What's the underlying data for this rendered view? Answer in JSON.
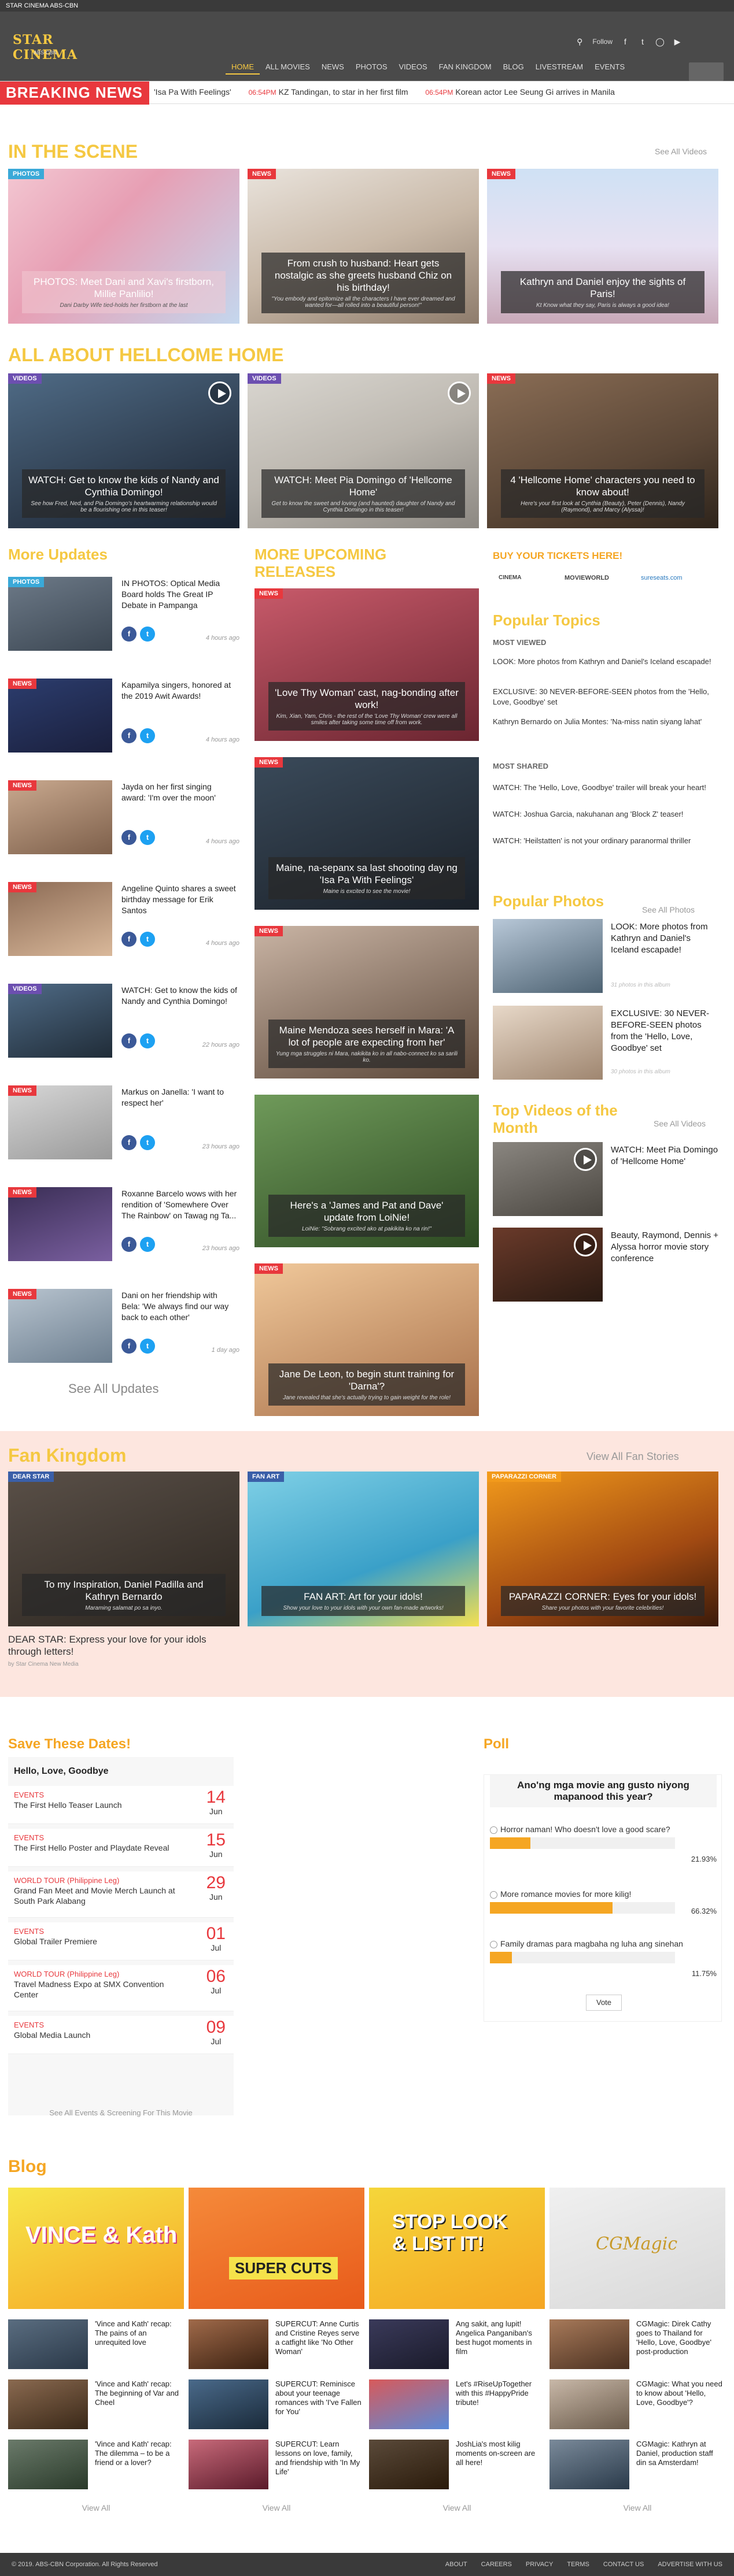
{
  "topbar": {
    "label": "STAR CINEMA ABS-CBN"
  },
  "header": {
    "logo_text": "STAR CINEMA",
    "logo_sub": "ABS-CBN",
    "follow_label": "Follow",
    "nav": [
      "HOME",
      "ALL MOVIES",
      "NEWS",
      "PHOTOS",
      "VIDEOS",
      "FAN KINGDOM",
      "BLOG",
      "LIVESTREAM",
      "EVENTS"
    ]
  },
  "breaking": {
    "label": "BREAKING NEWS",
    "items": [
      {
        "time": "",
        "text": "'Isa Pa With Feelings'"
      },
      {
        "time": "06:54PM",
        "text": "KZ Tandingan, to star in her first film"
      },
      {
        "time": "06:54PM",
        "text": "Korean actor Lee Seung Gi arrives in Manila"
      }
    ]
  },
  "scene": {
    "title": "IN THE SCENE",
    "see_all": "See All Videos",
    "cards": [
      {
        "tag": "PHOTOS",
        "headline": "PHOTOS: Meet Dani and Xavi's firstborn, Millie Panlilio!",
        "sub": "Dani Darby Wife tied-holds her firstborn at the last"
      },
      {
        "tag": "NEWS",
        "headline": "From crush to husband: Heart gets nostalgic as she greets husband Chiz on his birthday!",
        "sub": "\"You embody and epitomize all the characters I have ever dreamed and wanted for—all rolled into a beautiful person!\""
      },
      {
        "tag": "NEWS",
        "headline": "Kathryn and Daniel enjoy the sights of Paris!",
        "sub": "Kt Know what they say, Paris is always a good idea!"
      }
    ]
  },
  "hellcome": {
    "title": "ALL ABOUT HELLCOME HOME",
    "cards": [
      {
        "tag": "VIDEOS",
        "headline": "WATCH: Get to know the kids of Nandy and Cynthia Domingo!",
        "sub": "See how Fred, Ned, and Pia Domingo's heartwarming relationship would be a flourishing one in this teaser!"
      },
      {
        "tag": "VIDEOS",
        "headline": "WATCH: Meet Pia Domingo of 'Hellcome Home'",
        "sub": "Get to know the sweet and loving (and haunted) daughter of Nandy and Cynthia Domingo in this teaser!"
      },
      {
        "tag": "NEWS",
        "headline": "4 'Hellcome Home' characters you need to know about!",
        "sub": "Here's your first look at Cynthia (Beauty), Peter (Dennis), Nandy (Raymond), and Marcy (Alyssa)!"
      }
    ]
  },
  "more_updates": {
    "title": "More Updates",
    "see_all": "See All Updates",
    "items": [
      {
        "tag": "PHOTOS",
        "title": "IN PHOTOS: Optical Media Board holds The Great IP Debate in Pampanga",
        "time": "4 hours ago"
      },
      {
        "tag": "NEWS",
        "title": "Kapamilya singers, honored at the 2019 Awit Awards!",
        "time": "4 hours ago"
      },
      {
        "tag": "NEWS",
        "title": "Jayda on her first singing award: 'I'm over the moon'",
        "time": "4 hours ago"
      },
      {
        "tag": "NEWS",
        "title": "Angeline Quinto shares a sweet birthday message for Erik Santos",
        "time": "4 hours ago"
      },
      {
        "tag": "VIDEOS",
        "title": "WATCH: Get to know the kids of Nandy and Cynthia Domingo!",
        "time": "22 hours ago"
      },
      {
        "tag": "NEWS",
        "title": "Markus on Janella: 'I want to respect her'",
        "time": "23 hours ago"
      },
      {
        "tag": "NEWS",
        "title": "Roxanne Barcelo wows with her rendition of 'Somewhere Over The Rainbow' on Tawag ng Ta...",
        "time": "23 hours ago"
      },
      {
        "tag": "NEWS",
        "title": "Dani on her friendship with Bela: 'We always find our way back to each other'",
        "time": "1 day ago"
      }
    ]
  },
  "upcoming": {
    "title": "MORE UPCOMING RELEASES",
    "cards": [
      {
        "tag": "NEWS",
        "headline": "'Love Thy Woman' cast, nag-bonding after work!",
        "sub": "Kim, Xian, Yam, Chris - the rest of the 'Love Thy Woman' crew were all smiles after taking some time off from work."
      },
      {
        "tag": "NEWS",
        "headline": "Maine, na-sepanx sa last shooting day ng 'Isa Pa With Feelings'",
        "sub": "Maine is excited to see the movie!"
      },
      {
        "tag": "NEWS",
        "headline": "Maine Mendoza sees herself in Mara: 'A lot of people are expecting from her'",
        "sub": "Yung mga struggles ni Mara, nakikita ko in all nabo-connect ko sa sarili ko."
      },
      {
        "tag": "",
        "headline": "Here's a 'James and Pat and Dave' update from LoiNie!",
        "sub": "LoiNie: \"Sobrang excited ako at pakikita ko na rin!\""
      },
      {
        "tag": "NEWS",
        "headline": "Jane De Leon, to begin stunt training for 'Darna'?",
        "sub": "Jane revealed that she's actually trying to gain weight for the role!"
      }
    ]
  },
  "tickets": {
    "title": "BUY YOUR TICKETS HERE!",
    "partners": [
      "CINEMA",
      "MOVIEWORLD",
      "sureseats.com"
    ]
  },
  "popular_topics": {
    "title": "Popular Topics",
    "most_viewed_label": "MOST VIEWED",
    "most_viewed": [
      "LOOK: More photos from Kathryn and Daniel's Iceland escapade!",
      "EXCLUSIVE: 30 NEVER-BEFORE-SEEN photos from the 'Hello, Love, Goodbye' set",
      "Kathryn Bernardo on Julia Montes: 'Na-miss natin siyang lahat'"
    ],
    "most_shared_label": "MOST SHARED",
    "most_shared": [
      "WATCH: The 'Hello, Love, Goodbye' trailer will break your heart!",
      "WATCH: Joshua Garcia, nakuhanan ang 'Block Z' teaser!",
      "WATCH: 'Heilstatten' is not your ordinary paranormal thriller"
    ]
  },
  "popular_photos": {
    "title": "Popular Photos",
    "see_all": "See All Photos",
    "items": [
      {
        "title": "LOOK: More photos from Kathryn and Daniel's Iceland escapade!",
        "sub": "31 photos in this album"
      },
      {
        "title": "EXCLUSIVE: 30 NEVER-BEFORE-SEEN photos from the 'Hello, Love, Goodbye' set",
        "sub": "30 photos in this album"
      }
    ]
  },
  "top_videos": {
    "title": "Top Videos of the Month",
    "see_all": "See All Videos",
    "items": [
      {
        "title": "WATCH: Meet Pia Domingo of 'Hellcome Home'"
      },
      {
        "title": "Beauty, Raymond, Dennis + Alyssa horror movie story conference"
      }
    ]
  },
  "fan_kingdom": {
    "title": "Fan Kingdom",
    "see_all": "View All Fan Stories",
    "cards": [
      {
        "tag": "DEAR STAR",
        "headline": "To my Inspiration, Daniel Padilla and Kathryn Bernardo",
        "sub": "Maraming salamat po sa inyo."
      },
      {
        "tag": "FAN ART",
        "headline": "FAN ART: Art for your idols!",
        "sub": "Show your love to your idols with your own fan-made artworks!"
      },
      {
        "tag": "PAPARAZZI CORNER",
        "headline": "PAPARAZZI CORNER: Eyes for your idols!",
        "sub": "Share your photos with your favorite celebrities!"
      }
    ],
    "dear_star_text": "DEAR STAR: Express your love for your idols through letters!",
    "dear_star_by": "by Star Cinema New Media"
  },
  "dates": {
    "title": "Save These Dates!",
    "movie": "Hello, Love, Goodbye",
    "items": [
      {
        "cat": "EVENTS",
        "event": "The First Hello Teaser Launch",
        "day": "14",
        "month": "Jun"
      },
      {
        "cat": "EVENTS",
        "event": "The First Hello Poster and Playdate Reveal",
        "day": "15",
        "month": "Jun"
      },
      {
        "cat": "WORLD TOUR (Philippine Leg)",
        "event": "Grand Fan Meet and Movie Merch Launch at South Park Alabang",
        "day": "29",
        "month": "Jun"
      },
      {
        "cat": "EVENTS",
        "event": "Global Trailer Premiere",
        "day": "01",
        "month": "Jul"
      },
      {
        "cat": "WORLD TOUR (Philippine Leg)",
        "event": "Travel Madness Expo at SMX Convention Center",
        "day": "06",
        "month": "Jul"
      },
      {
        "cat": "EVENTS",
        "event": "Global Media Launch",
        "day": "09",
        "month": "Jul"
      }
    ],
    "see_all": "See All Events & Screening For This Movie"
  },
  "poll": {
    "title": "Poll",
    "question": "Ano'ng mga movie ang gusto niyong mapanood this year?",
    "options": [
      {
        "label": "Horror naman! Who doesn't love a good scare?",
        "pct": 21.93,
        "pct_text": "21.93%"
      },
      {
        "label": "More romance movies for more kilig!",
        "pct": 66.32,
        "pct_text": "66.32%"
      },
      {
        "label": "Family dramas para magbaha ng luha ang sinehan",
        "pct": 11.75,
        "pct_text": "11.75%"
      }
    ],
    "vote": "Vote"
  },
  "blog": {
    "title": "Blog",
    "columns": [
      {
        "banner": "VINCE & Kath",
        "items": [
          "'Vince and Kath' recap: The pains of an unrequited love",
          "'Vince and Kath' recap: The beginning of Var and Cheel",
          "'Vince and Kath' recap: The dilemma – to be a friend or a lover?"
        ],
        "view_all": "View All"
      },
      {
        "banner": "SUPER CUTS",
        "items": [
          "SUPERCUT: Anne Curtis and Cristine Reyes serve a catfight like 'No Other Woman'",
          "SUPERCUT: Reminisce about your teenage romances with 'I've Fallen for You'",
          "SUPERCUT: Learn lessons on love, family, and friendship with 'In My Life'"
        ],
        "view_all": "View All"
      },
      {
        "banner": "STOP LOOK & LIST IT!",
        "items": [
          "Ang sakit, ang lupit! Angelica Panganiban's best hugot moments in film",
          "Let's #RiseUpTogether with this #HappyPride tribute!",
          "JoshLia's most kilig moments on-screen are all here!"
        ],
        "view_all": "View All"
      },
      {
        "banner": "CGMagic",
        "items": [
          "CGMagic: Direk Cathy goes to Thailand for 'Hello, Love, Goodbye' post-production",
          "CGMagic: What you need to know about 'Hello, Love, Goodbye'?",
          "CGMagic: Kathryn at Daniel, production staff din sa Amsterdam!"
        ],
        "view_all": "View All"
      }
    ]
  },
  "footer": {
    "copy": "© 2019. ABS-CBN Corporation. All Rights Reserved",
    "links": [
      "ABOUT",
      "CAREERS",
      "PRIVACY",
      "TERMS",
      "CONTACT US",
      "ADVERTISE WITH US"
    ]
  },
  "colors": {
    "accent": "#f5c842",
    "news": "#e8383d",
    "photos": "#3aa9d8",
    "videos": "#6c4fb0",
    "header": "#4a4a4a"
  }
}
